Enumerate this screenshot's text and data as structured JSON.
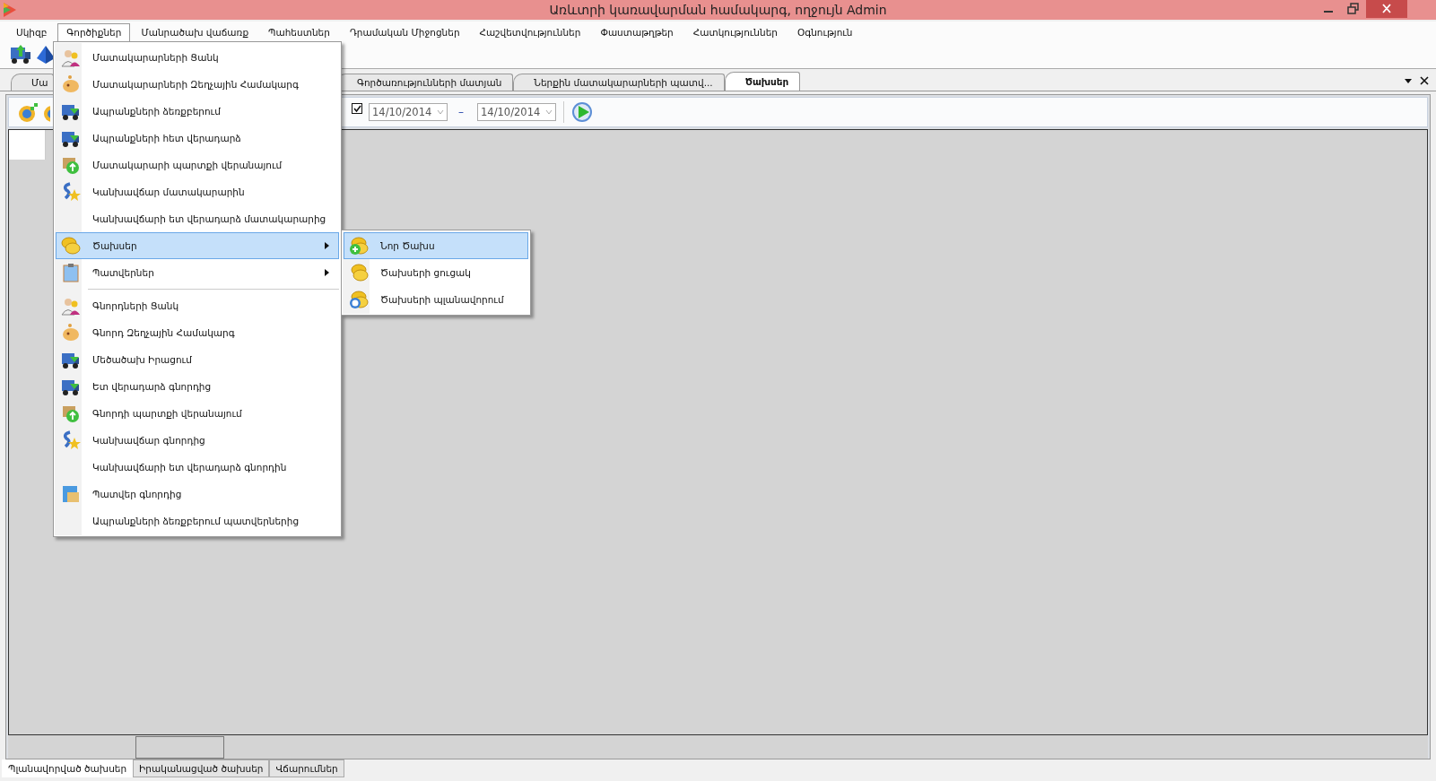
{
  "window": {
    "title": "Առևտրի կառավարման համակարգ, ողջույն Admin"
  },
  "menu_bar": [
    {
      "label": "Սկիզբ",
      "selected": false
    },
    {
      "label": "Գործիքներ",
      "selected": true
    },
    {
      "label": "Մանրածախ վաճառք",
      "selected": false
    },
    {
      "label": "Պահեստներ",
      "selected": false
    },
    {
      "label": "Դրամական Միջոցներ",
      "selected": false
    },
    {
      "label": "Հաշվետվություններ",
      "selected": false
    },
    {
      "label": "Փաստաթղթեր",
      "selected": false
    },
    {
      "label": "Հատկություններ",
      "selected": false
    },
    {
      "label": "Օգնություն",
      "selected": false
    }
  ],
  "tabs": [
    {
      "label": "Մա",
      "selected": false
    },
    {
      "label": "Գործառությունների մատյան",
      "selected": false
    },
    {
      "label": "Ներքին մատակարարների պատվ...",
      "selected": false
    },
    {
      "label": "Ծախսեր",
      "selected": true
    }
  ],
  "filter": {
    "checked": true,
    "date_from": "14/10/2014",
    "separator": "–",
    "date_to": "14/10/2014"
  },
  "dropdown": {
    "items": [
      {
        "label": "Մատակարարների Ցանկ",
        "selected": false,
        "submenu": false
      },
      {
        "label": "Մատակարարների Զեղչային Համակարգ",
        "selected": false,
        "submenu": false
      },
      {
        "label": "Ապրանքների ձեռքբերում",
        "selected": false,
        "submenu": false
      },
      {
        "label": "Ապրանքների հետ վերադարձ",
        "selected": false,
        "submenu": false
      },
      {
        "label": "Մատակարարի պարտքի վերանայում",
        "selected": false,
        "submenu": false
      },
      {
        "label": "Կանխավճար մատակարարին",
        "selected": false,
        "submenu": false
      },
      {
        "label": "Կանխավճարի ետ վերադարձ մատակարարից",
        "selected": false,
        "submenu": false
      },
      {
        "label": "Ծախսեր",
        "selected": true,
        "submenu": true
      },
      {
        "label": "Պատվերներ",
        "selected": false,
        "submenu": true
      },
      {
        "kind": "separator"
      },
      {
        "label": "Գնորդների Ցանկ",
        "selected": false,
        "submenu": false
      },
      {
        "label": "Գնորդ Զեղչային Համակարգ",
        "selected": false,
        "submenu": false
      },
      {
        "label": "Մեծածախ Իրացում",
        "selected": false,
        "submenu": false
      },
      {
        "label": "Ետ վերադարձ գնորդից",
        "selected": false,
        "submenu": false
      },
      {
        "label": "Գնորդի պարտքի վերանայում",
        "selected": false,
        "submenu": false
      },
      {
        "label": "Կանխավճար գնորդից",
        "selected": false,
        "submenu": false
      },
      {
        "label": "Կանխավճարի ետ վերադարձ գնորդին",
        "selected": false,
        "submenu": false
      },
      {
        "label": "Պատվեր գնորդից",
        "selected": false,
        "submenu": false
      },
      {
        "label": "Ապրանքների ձեռքբերում պատվերներից",
        "selected": false,
        "submenu": false
      }
    ]
  },
  "submenu": {
    "items": [
      {
        "label": "Նոր Ծախս",
        "selected": true
      },
      {
        "label": "Ծախսերի ցուցակ",
        "selected": false
      },
      {
        "label": "Ծախսերի պլանավորում",
        "selected": false
      }
    ]
  },
  "bottom_tabs": [
    {
      "label": "Պլանավորված ծախսեր",
      "selected": true
    },
    {
      "label": "Իրականացված ծախսեր",
      "selected": false
    },
    {
      "label": "Վճարումներ",
      "selected": false
    }
  ]
}
